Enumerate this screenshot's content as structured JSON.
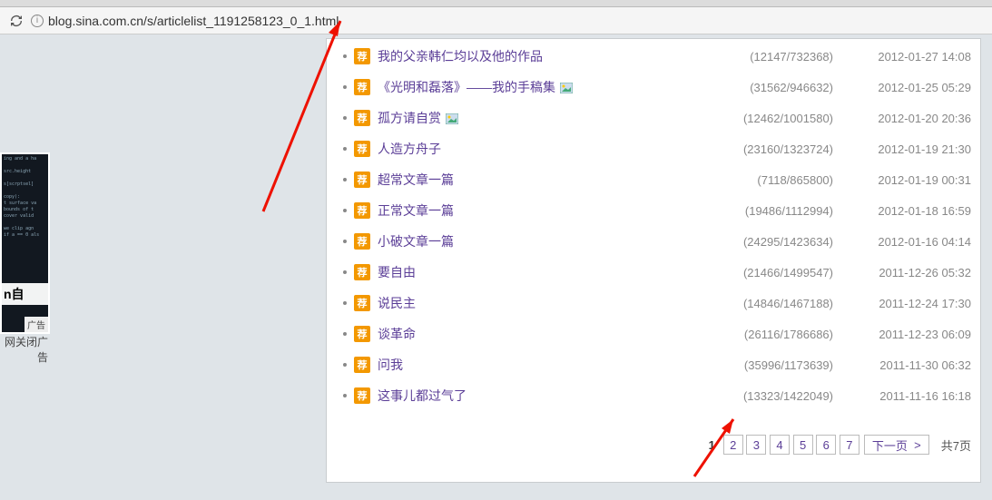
{
  "url": "blog.sina.com.cn/s/articlelist_1191258123_0_1.html",
  "badge_char": "荐",
  "articles": [
    {
      "title": "我的父亲韩仁均以及他的作品",
      "stats": "(12147/732368)",
      "date": "2012-01-27 14:08",
      "has_image": false
    },
    {
      "title": "《光明和磊落》——我的手稿集",
      "stats": "(31562/946632)",
      "date": "2012-01-25 05:29",
      "has_image": true
    },
    {
      "title": "孤方请自赏",
      "stats": "(12462/1001580)",
      "date": "2012-01-20 20:36",
      "has_image": true
    },
    {
      "title": "人造方舟子",
      "stats": "(23160/1323724)",
      "date": "2012-01-19 21:30",
      "has_image": false
    },
    {
      "title": "超常文章一篇",
      "stats": "(7118/865800)",
      "date": "2012-01-19 00:31",
      "has_image": false
    },
    {
      "title": "正常文章一篇",
      "stats": "(19486/1112994)",
      "date": "2012-01-18 16:59",
      "has_image": false
    },
    {
      "title": "小破文章一篇",
      "stats": "(24295/1423634)",
      "date": "2012-01-16 04:14",
      "has_image": false
    },
    {
      "title": "要自由",
      "stats": "(21466/1499547)",
      "date": "2011-12-26 05:32",
      "has_image": false
    },
    {
      "title": "说民主",
      "stats": "(14846/1467188)",
      "date": "2011-12-24 17:30",
      "has_image": false
    },
    {
      "title": "谈革命",
      "stats": "(26116/1786686)",
      "date": "2011-12-23 06:09",
      "has_image": false
    },
    {
      "title": "问我",
      "stats": "(35996/1173639)",
      "date": "2011-11-30 06:32",
      "has_image": false
    },
    {
      "title": "这事儿都过气了",
      "stats": "(13323/1422049)",
      "date": "2011-11-16 16:18",
      "has_image": false
    }
  ],
  "pagination": {
    "current": "1",
    "pages": [
      "2",
      "3",
      "4",
      "5",
      "6",
      "7"
    ],
    "next_label": "下一页",
    "total_label": "共7页"
  },
  "sidebar": {
    "thumb_label": "n自",
    "ad_tag": "广告",
    "close_text": "网关闭广告"
  }
}
